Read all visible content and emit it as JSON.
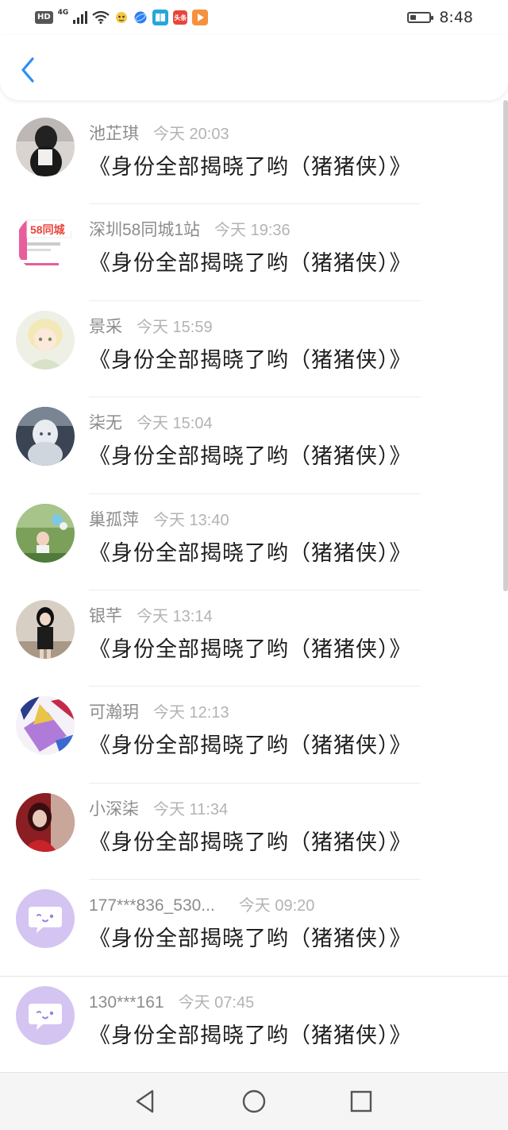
{
  "status_bar": {
    "hd": "HD",
    "network": "4G",
    "clock": "8:48",
    "battery_level": 0.3,
    "app_icons": [
      "toutiao-icon",
      "play-icon"
    ],
    "toutiao_label": "头条"
  },
  "header": {
    "back_icon": "chevron-left-icon",
    "accent_color": "#2c8ef8"
  },
  "messages": [
    {
      "name": "池芷琪",
      "time": "今天 20:03",
      "text": "《身份全部揭晓了哟（猪猪侠）》",
      "avatar": "photo"
    },
    {
      "name": "深圳58同城1站",
      "time": "今天 19:36",
      "text": "《身份全部揭晓了哟（猪猪侠）》",
      "avatar": "58-logo",
      "avatar_label": "58同城"
    },
    {
      "name": "景采",
      "time": "今天 15:59",
      "text": "《身份全部揭晓了哟（猪猪侠）》",
      "avatar": "anime"
    },
    {
      "name": "柒无",
      "time": "今天 15:04",
      "text": "《身份全部揭晓了哟（猪猪侠）》",
      "avatar": "anime-dark"
    },
    {
      "name": "巢孤萍",
      "time": "今天 13:40",
      "text": "《身份全部揭晓了哟（猪猪侠）》",
      "avatar": "outdoor"
    },
    {
      "name": "银芊",
      "time": "今天 13:14",
      "text": "《身份全部揭晓了哟（猪猪侠）》",
      "avatar": "photo-dark"
    },
    {
      "name": "可瀚玥",
      "time": "今天 12:13",
      "text": "《身份全部揭晓了哟（猪猪侠）》",
      "avatar": "colorful"
    },
    {
      "name": "小深柒",
      "time": "今天 11:34",
      "text": "《身份全部揭晓了哟（猪猪侠）》",
      "avatar": "red"
    },
    {
      "name": "177***836_530...",
      "time": "今天 09:20",
      "text": "《身份全部揭晓了哟（猪猪侠）》",
      "avatar": "default-chat"
    },
    {
      "name": "130***161",
      "time": "今天 07:45",
      "text": "《身份全部揭晓了哟（猪猪侠）》",
      "avatar": "default-chat"
    }
  ],
  "nav_bar": {
    "back": "triangle-back-icon",
    "home": "circle-home-icon",
    "recents": "square-recents-icon"
  }
}
